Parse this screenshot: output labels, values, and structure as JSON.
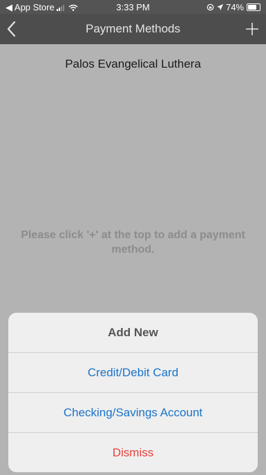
{
  "status_bar": {
    "back_app": "◀ App Store",
    "time": "3:33 PM",
    "battery": "74%",
    "battery_level": 0.74
  },
  "nav": {
    "title": "Payment Methods",
    "back_icon": "chevron-left-icon",
    "add_icon": "plus-icon"
  },
  "subtitle": "Palos Evangelical Luthera",
  "empty_message": "Please click '+' at the top to add a payment method.",
  "action_sheet": {
    "title": "Add New",
    "options": [
      "Credit/Debit Card",
      "Checking/Savings Account"
    ],
    "dismiss": "Dismiss"
  },
  "colors": {
    "nav_bg": "#4d4d4d",
    "background": "#b3b3b3",
    "link_blue": "#1a73c8",
    "dismiss_red": "#e8413b"
  }
}
